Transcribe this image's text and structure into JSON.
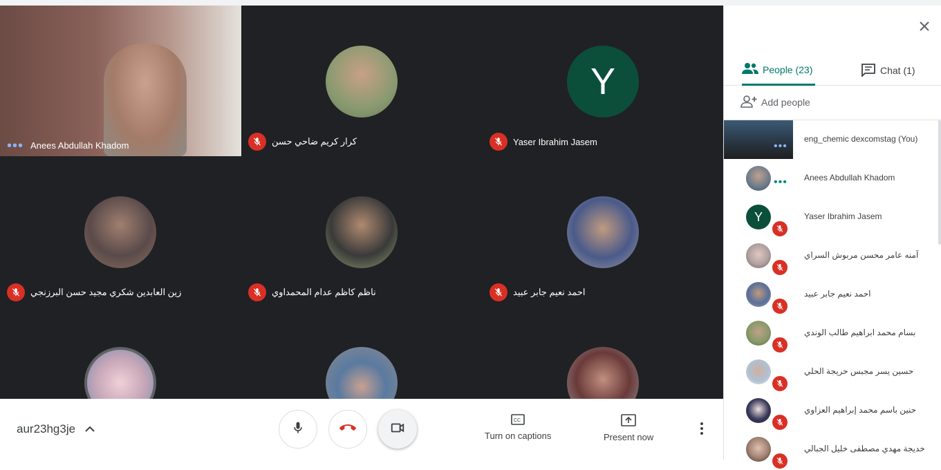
{
  "tiles": [
    {
      "name": "Anees Abdullah Khadom",
      "status": "speaking",
      "kind": "video"
    },
    {
      "name": "كرار كريم ضاحي حسن",
      "status": "muted",
      "kind": "photo",
      "color": "#7a8a6a"
    },
    {
      "name": "Yaser Ibrahim Jasem",
      "status": "muted",
      "kind": "letter",
      "letter": "Y",
      "color": "#0b4f3a"
    },
    {
      "name": "زين العابدين شكري مجيد حسن البرزنجي",
      "status": "muted",
      "kind": "photo",
      "color": "#8b6f5a"
    },
    {
      "name": "ناظم كاظم عدام المحمداوي",
      "status": "muted",
      "kind": "photo",
      "color": "#6f7a5a"
    },
    {
      "name": "احمد نعيم جابر عبيد",
      "status": "muted",
      "kind": "photo",
      "color": "#5a6f9a"
    },
    {
      "name": "",
      "status": "muted",
      "kind": "photo",
      "color": "#c8a8b8"
    },
    {
      "name": "",
      "status": "muted",
      "kind": "photo",
      "color": "#5a7aa0"
    },
    {
      "name": "",
      "status": "muted",
      "kind": "photo",
      "color": "#9a7060"
    }
  ],
  "bottom": {
    "meeting_code": "aur23hg3je",
    "captions_label": "Turn on captions",
    "present_label": "Present now"
  },
  "panel": {
    "tabs": [
      {
        "label": "People (23)"
      },
      {
        "label": "Chat (1)"
      }
    ],
    "add_people": "Add people",
    "people": [
      {
        "name": "eng_chemic dexcomstag (You)",
        "status": "self"
      },
      {
        "name": "Anees Abdullah Khadom",
        "status": "speaking",
        "color": "#6a7a8a"
      },
      {
        "name": "Yaser Ibrahim Jasem",
        "status": "muted",
        "letter": "Y",
        "color": "#0b4f3a"
      },
      {
        "name": "آمنه عامر محسن مربوش السراي",
        "status": "muted",
        "color": "#b0a0a0"
      },
      {
        "name": "احمد نعيم جابر عبيد",
        "status": "muted",
        "color": "#5a6f9a"
      },
      {
        "name": "بسام محمد ابراهيم طالب الوندي",
        "status": "muted",
        "color": "#8a9a6a"
      },
      {
        "name": "حسين يسر مجبس حريجة الحلي",
        "status": "muted",
        "color": "#b0c0d0"
      },
      {
        "name": "حنين باسم محمد إبراهيم العزاوي",
        "status": "muted",
        "color": "#3a3a5a"
      },
      {
        "name": "خديجة مهدي مصطفى خليل الجبالي",
        "status": "muted",
        "color": "#a08070"
      }
    ]
  },
  "colors": {
    "accent": "#00796b",
    "muted_red": "#d93025",
    "stage_bg": "#202124"
  }
}
